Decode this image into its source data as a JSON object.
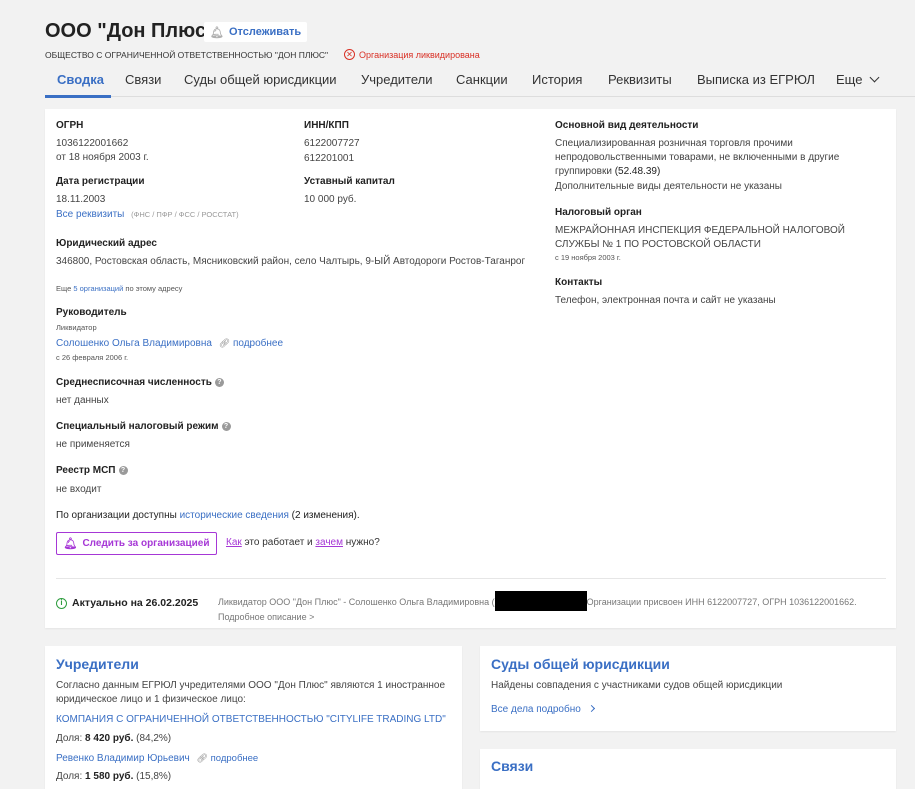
{
  "header": {
    "title": "ООО \"Дон Плюс\"",
    "track_label": "Отслеживать",
    "full_name": "ОБЩЕСТВО С ОГРАНИЧЕННОЙ ОТВЕТСТВЕННОСТЬЮ \"ДОН ПЛЮС\"",
    "status": "Организация ликвидирована"
  },
  "tabs": [
    {
      "label": "Сводка",
      "active": true
    },
    {
      "label": "Связи"
    },
    {
      "label": "Суды общей юрисдикции"
    },
    {
      "label": "Учредители"
    },
    {
      "label": "Санкции"
    },
    {
      "label": "История"
    },
    {
      "label": "Реквизиты"
    },
    {
      "label": "Выписка из ЕГРЮЛ"
    },
    {
      "label": "Еще"
    }
  ],
  "summary": {
    "ogrn_label": "ОГРН",
    "ogrn_value": "1036122001662",
    "ogrn_date": "от 18 ноября 2003 г.",
    "inn_label": "ИНН/КПП",
    "inn_value": "6122007727",
    "kpp_value": "612201001",
    "reg_label": "Дата регистрации",
    "reg_value": "18.11.2003",
    "capital_label": "Уставный капитал",
    "capital_value": "10 000 руб.",
    "all_req_link": "Все реквизиты",
    "all_req_note": "(ФНС / ПФР / ФСС / РОССТАТ)",
    "address_label": "Юридический адрес",
    "address_value": "346800, Ростовская область, Мясниковский район, село Чалтырь, 9-ЫЙ Автодороги Ростов-Таганрог",
    "address_more_prefix": "Еще",
    "address_more_link": "5 организаций",
    "address_more_suffix": "по этому адресу",
    "head_label": "Руководитель",
    "head_role": "Ликвидатор",
    "head_name": "Солошенко Ольга Владимировна",
    "head_more": "подробнее",
    "head_since": "с 26 февраля 2006 г.",
    "staff_label": "Среднесписочная численность",
    "staff_value": "нет данных",
    "tax_regime_label": "Специальный налоговый режим",
    "tax_regime_value": "не применяется",
    "msp_label": "Реестр МСП",
    "msp_value": "не входит",
    "history_prefix": "По организации доступны",
    "history_link": "исторические сведения",
    "history_suffix": "(2 изменения).",
    "follow_label": "Следить за организацией",
    "how_link": "Как",
    "how_mid": "это работает и",
    "why_link": "зачем",
    "how_end": "нужно?",
    "activity_label": "Основной вид деятельности",
    "activity_value": "Специализированная розничная торговля прочими непродовольственными товарами, не включенными в другие группировки",
    "activity_code": "(52.48.39)",
    "activity_extra": "Дополнительные виды деятельности не указаны",
    "taxorg_label": "Налоговый орган",
    "taxorg_value": "МЕЖРАЙОННАЯ ИНСПЕКЦИЯ ФЕДЕРАЛЬНОЙ НАЛОГОВОЙ СЛУЖБЫ № 1 ПО РОСТОВСКОЙ ОБЛАСТИ",
    "taxorg_since": "с 19 ноября 2003 г.",
    "contacts_label": "Контакты",
    "contacts_value": "Телефон, электронная почта и сайт не указаны",
    "actual_label": "Актуально на 26.02.2025",
    "news_part1": "Ликвидатор ООО \"Дон Плюс\" - Солошенко Ольга Владимировна (",
    "news_part2": "Организации присвоен ИНН 6122007727, ОГРН 1036122001662. Подробное описание >"
  },
  "founders": {
    "title": "Учредители",
    "desc": "Согласно данным ЕГРЮЛ учредителями ООО \"Дон Плюс\" являются 1 иностранное юридическое лицо и 1 физическое лицо:",
    "items": [
      {
        "name": "КОМПАНИЯ С ОГРАНИЧЕННОЙ ОТВЕТСТВЕННОСТЬЮ \"CITYLIFE TRADING LTD\"",
        "share_label": "Доля:",
        "share_value": "8 420 руб.",
        "share_pct": "(84,2%)"
      },
      {
        "name": "Ревенко Владимир Юрьевич",
        "more": "подробнее",
        "share_label": "Доля:",
        "share_value": "1 580 руб.",
        "share_pct": "(15,8%)"
      }
    ]
  },
  "courts": {
    "title": "Суды общей юрисдикции",
    "desc": "Найдены совпадения с участниками судов общей юрисдикции",
    "link": "Все дела подробно"
  },
  "links": {
    "title": "Связи"
  }
}
